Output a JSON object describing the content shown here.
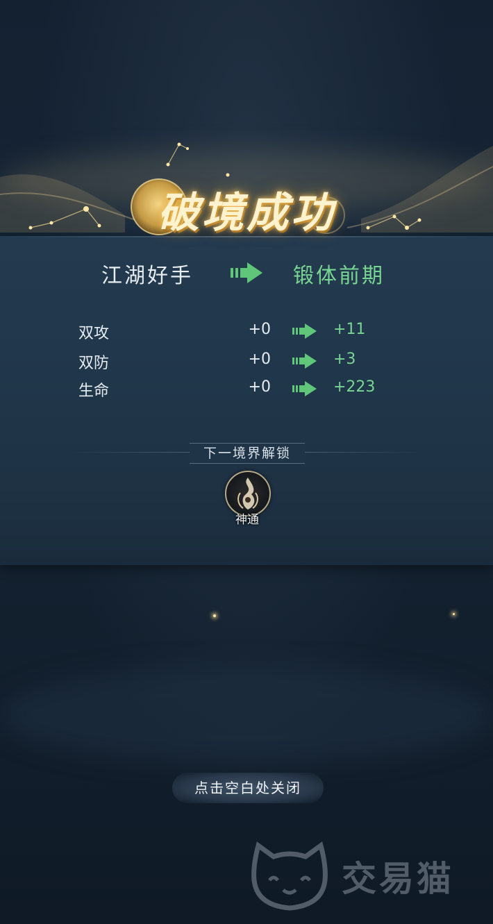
{
  "title": "破境成功",
  "rank": {
    "from": "江湖好手",
    "to": "锻体前期"
  },
  "stats": [
    {
      "label": "双攻",
      "before": "+0",
      "after": "+11"
    },
    {
      "label": "双防",
      "before": "+0",
      "after": "+3"
    },
    {
      "label": "生命",
      "before": "+0",
      "after": "+223"
    }
  ],
  "next_realm": {
    "heading": "下一境界解锁",
    "unlocks": [
      {
        "name": "神通",
        "icon": "flame-spirit-icon"
      }
    ]
  },
  "close_hint": "点击空白处关闭",
  "watermark": {
    "brand": "交易猫",
    "logo_icon": "cat-face-logo"
  },
  "colors": {
    "gain": "#78d693",
    "title_glow": "#f3c766",
    "panel": "#21374b"
  }
}
